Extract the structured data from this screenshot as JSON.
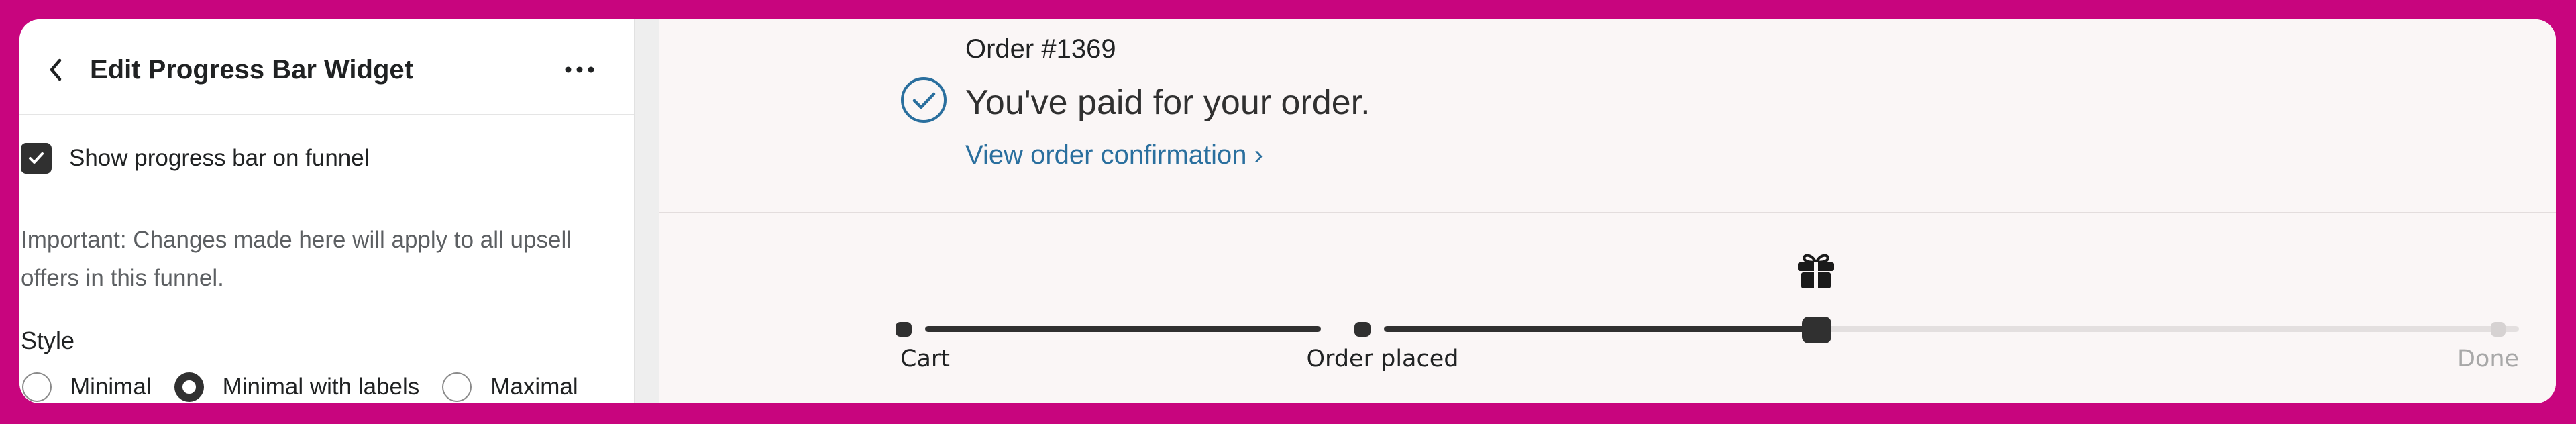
{
  "sidebar": {
    "title": "Edit Progress Bar Widget",
    "back_icon": "chevron-left-icon",
    "more_icon": "more-horizontal-icon",
    "show_progress_checkbox": {
      "label": "Show progress bar on funnel",
      "checked": true
    },
    "important_note": "Important: Changes made here will apply to all upsell offers in this funnel.",
    "style": {
      "label": "Style",
      "options": [
        {
          "label": "Minimal",
          "selected": false
        },
        {
          "label": "Minimal with labels",
          "selected": true
        },
        {
          "label": "Maximal",
          "selected": false
        }
      ]
    }
  },
  "preview": {
    "order_number": "Order #1369",
    "paid_title": "You've paid for your order.",
    "view_confirmation_link": "View order confirmation ›",
    "status_icon": "check-circle-icon",
    "progress": {
      "gift_icon": "gift-icon",
      "steps": [
        {
          "label": "Cart"
        },
        {
          "label": "Order placed"
        },
        {
          "label": ""
        },
        {
          "label": "Done"
        }
      ],
      "current_fraction": 0.58
    }
  },
  "colors": {
    "background_frame": "#c8057e",
    "progress_active": "#303030",
    "progress_inactive": "#e3dfdf",
    "link": "#2a6f9e",
    "check_circle": "#2a6f9e",
    "done_label": "#a8a8a8"
  }
}
